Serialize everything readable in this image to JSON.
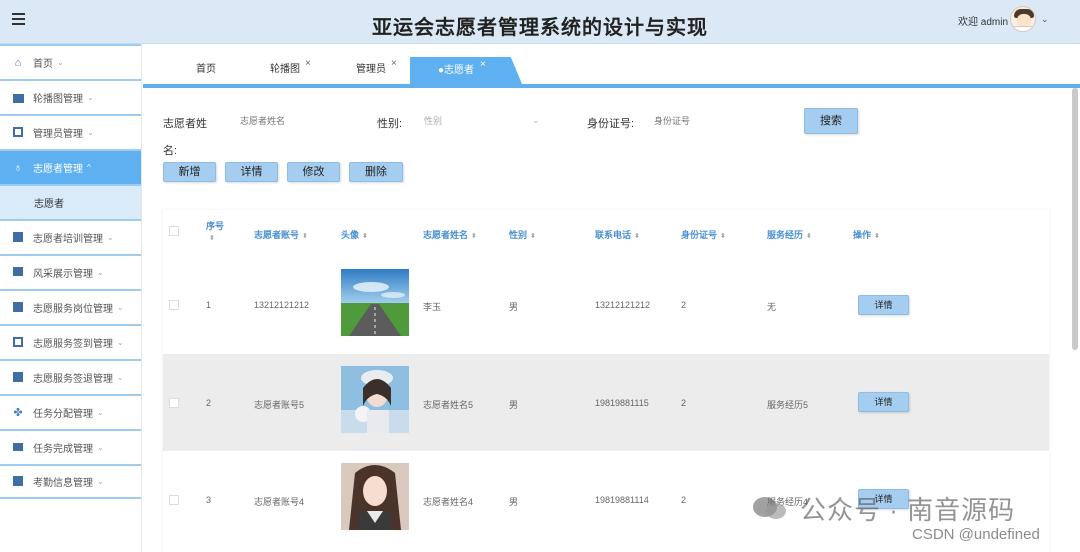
{
  "header": {
    "title": "亚运会志愿者管理系统的设计与实现",
    "welcome": "欢迎 admin"
  },
  "sidebar": {
    "items": [
      {
        "label": "首页"
      },
      {
        "label": "轮播图管理"
      },
      {
        "label": "管理员管理"
      },
      {
        "label": "志愿者管理",
        "sub": "志愿者"
      },
      {
        "label": "志愿者培训管理"
      },
      {
        "label": "风采展示管理"
      },
      {
        "label": "志愿服务岗位管理"
      },
      {
        "label": "志愿服务签到管理"
      },
      {
        "label": "志愿服务签退管理"
      },
      {
        "label": "任务分配管理"
      },
      {
        "label": "任务完成管理"
      },
      {
        "label": "考勤信息管理"
      }
    ]
  },
  "tabs": [
    "首页",
    "轮播图",
    "管理员",
    "●志愿者"
  ],
  "search": {
    "name_label": "志愿者姓",
    "name_label_wrap": "名:",
    "name_placeholder": "志愿者姓名",
    "gender_label": "性别:",
    "gender_placeholder": "性别",
    "id_label": "身份证号:",
    "id_placeholder": "身份证号",
    "search_button": "搜索"
  },
  "actions": {
    "add": "新增",
    "detail": "详情",
    "edit": "修改",
    "delete": "删除"
  },
  "table": {
    "headers": {
      "index": "序号",
      "account": "志愿者账号",
      "avatar": "头像",
      "name": "志愿者姓名",
      "gender": "性别",
      "phone": "联系电话",
      "id_number": "身份证号",
      "history": "服务经历",
      "ops": "操作"
    },
    "rows": [
      {
        "index": "1",
        "account": "13212121212",
        "name": "李玉",
        "gender": "男",
        "phone": "13212121212",
        "id_number": "2",
        "history": "无",
        "op": "详情"
      },
      {
        "index": "2",
        "account": "志愿者账号5",
        "name": "志愿者姓名5",
        "gender": "男",
        "phone": "19819881115",
        "id_number": "2",
        "history": "服务经历5",
        "op": "详情"
      },
      {
        "index": "3",
        "account": "志愿者账号4",
        "name": "志愿者姓名4",
        "gender": "男",
        "phone": "19819881114",
        "id_number": "2",
        "history": "服务经历4",
        "op": "详情"
      }
    ]
  },
  "watermark": {
    "text": "公众号 · 南音源码",
    "csdn": "CSDN @undefined"
  },
  "colors": {
    "accent": "#5fb0f0",
    "header_bg": "#dbe9f7",
    "button_bg": "#a5cdef"
  }
}
